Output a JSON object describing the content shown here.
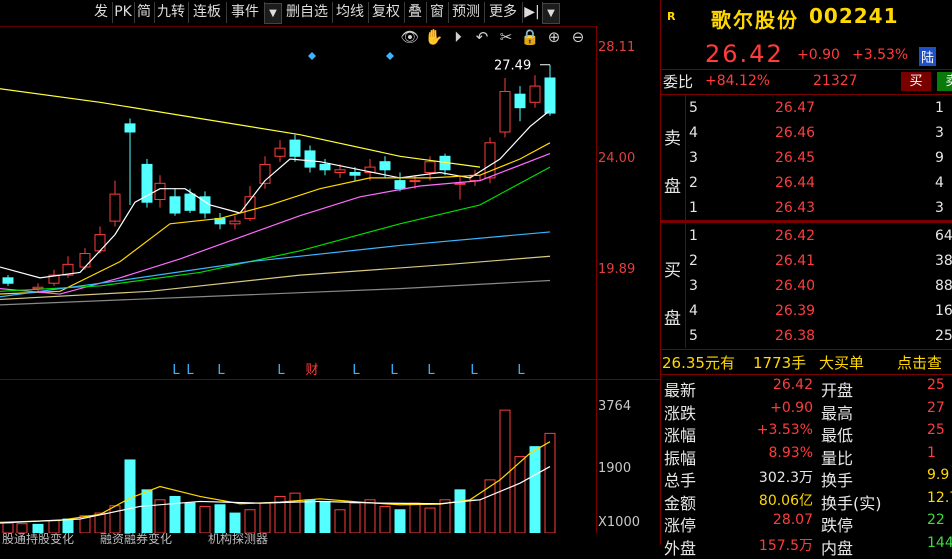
{
  "toolbar": {
    "buttons": [
      "发",
      "PK",
      "简",
      "九转",
      "连板",
      "事件",
      "▼",
      "删自选",
      "均线",
      "复权",
      "叠",
      "窗",
      "预测",
      "更多",
      "▶|",
      "▼"
    ]
  },
  "chart_tools": [
    "eye-icon",
    "hand-icon",
    "play-icon",
    "undo-icon",
    "scissors-icon",
    "lock-icon",
    "zoom-in-icon",
    "zoom-out-icon"
  ],
  "price_axis": {
    "top": "28.11",
    "mid": "24.00",
    "low": "19.89"
  },
  "volume_axis": {
    "top": "3764",
    "mid": "1900",
    "unit": "X1000"
  },
  "high_annotation": "27.49",
  "event_markers": [
    "L",
    "L",
    "L",
    "L",
    "财",
    "L",
    "L",
    "L",
    "L",
    "L",
    "L"
  ],
  "bottom_tabs": [
    "股通持股变化",
    "融资融券变化",
    "机构探测器"
  ],
  "stock": {
    "flag": "R",
    "name": "歌尔股份",
    "code": "002241",
    "price": "26.42",
    "change": "+0.90",
    "pct": "+3.53%",
    "badge": "陆"
  },
  "weibi": {
    "label": "委比",
    "value": "+84.12%",
    "diff": "21327",
    "buy_btn": "买",
    "sell_btn": "卖"
  },
  "asks_label": [
    "卖",
    "盘"
  ],
  "bids_label": [
    "买",
    "盘"
  ],
  "asks": [
    {
      "level": "5",
      "price": "26.47",
      "vol": "1"
    },
    {
      "level": "4",
      "price": "26.46",
      "vol": "3"
    },
    {
      "level": "3",
      "price": "26.45",
      "vol": "9"
    },
    {
      "level": "2",
      "price": "26.44",
      "vol": "4"
    },
    {
      "level": "1",
      "price": "26.43",
      "vol": "3"
    }
  ],
  "bids": [
    {
      "level": "1",
      "price": "26.42",
      "vol": "64"
    },
    {
      "level": "2",
      "price": "26.41",
      "vol": "38"
    },
    {
      "level": "3",
      "price": "26.40",
      "vol": "88"
    },
    {
      "level": "4",
      "price": "26.39",
      "vol": "16"
    },
    {
      "level": "5",
      "price": "26.38",
      "vol": "25"
    }
  ],
  "big_order": {
    "price": "26.35元有",
    "qty": "1773手",
    "label": "大买单",
    "link": "点击查"
  },
  "stats": [
    {
      "l1": "最新",
      "v1": "26.42",
      "c1": "red",
      "l2": "开盘",
      "v2": "25",
      "c2": "red"
    },
    {
      "l1": "涨跌",
      "v1": "+0.90",
      "c1": "red",
      "l2": "最高",
      "v2": "27",
      "c2": "red"
    },
    {
      "l1": "涨幅",
      "v1": "+3.53%",
      "c1": "red",
      "l2": "最低",
      "v2": "25",
      "c2": "red"
    },
    {
      "l1": "振幅",
      "v1": "8.93%",
      "c1": "red",
      "l2": "量比",
      "v2": "1",
      "c2": "red"
    },
    {
      "l1": "总手",
      "v1": "302.3万",
      "c1": "wht",
      "l2": "换手",
      "v2": "9.9",
      "c2": "yel"
    },
    {
      "l1": "金额",
      "v1": "80.06亿",
      "c1": "yel",
      "l2": "换手(实)",
      "v2": "12.7",
      "c2": "yel"
    },
    {
      "l1": "涨停",
      "v1": "28.07",
      "c1": "red",
      "l2": "跌停",
      "v2": "22",
      "c2": "grn"
    },
    {
      "l1": "外盘",
      "v1": "157.5万",
      "c1": "red",
      "l2": "内盘",
      "v2": "144",
      "c2": "grn"
    }
  ]
}
